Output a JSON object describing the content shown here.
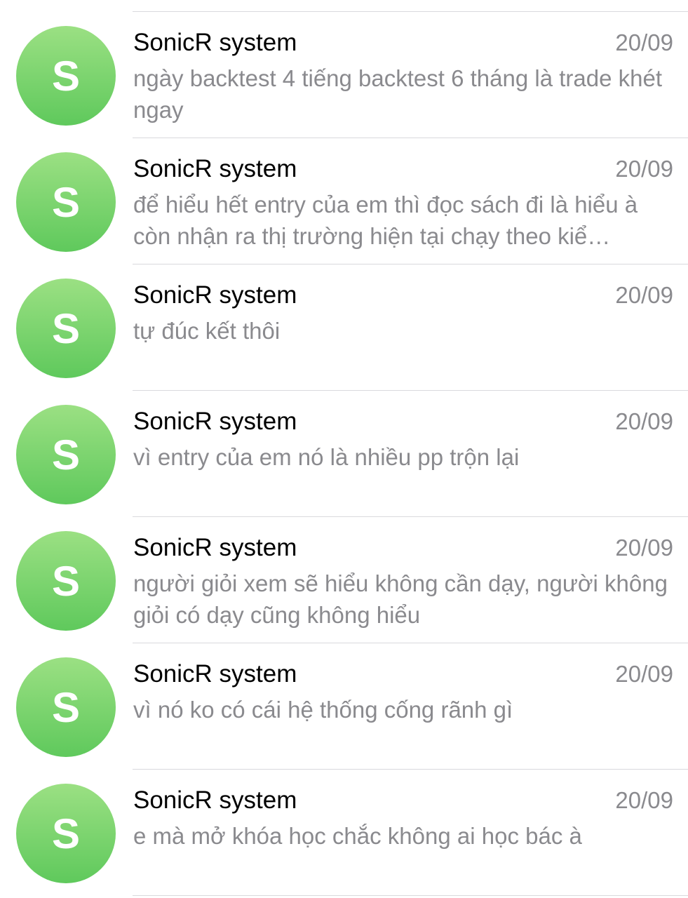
{
  "conversations": [
    {
      "avatar_letter": "S",
      "name": "SonicR system",
      "date": "20/09",
      "preview": "ngày backtest 4 tiếng backtest 6 tháng là trade khét ngay"
    },
    {
      "avatar_letter": "S",
      "name": "SonicR system",
      "date": "20/09",
      "preview": "để hiểu hết entry của em thì đọc sách đi là hiểu à còn nhận ra thị trường hiện tại chạy theo kiể…"
    },
    {
      "avatar_letter": "S",
      "name": "SonicR system",
      "date": "20/09",
      "preview": "tự đúc kết thôi"
    },
    {
      "avatar_letter": "S",
      "name": "SonicR system",
      "date": "20/09",
      "preview": "vì entry của em nó là nhiều pp trộn lại"
    },
    {
      "avatar_letter": "S",
      "name": "SonicR system",
      "date": "20/09",
      "preview": "người giỏi xem sẽ hiểu không cần dạy, người không giỏi có dạy cũng không hiểu"
    },
    {
      "avatar_letter": "S",
      "name": "SonicR system",
      "date": "20/09",
      "preview": "vì nó ko có cái hệ thống cống rãnh gì"
    },
    {
      "avatar_letter": "S",
      "name": "SonicR system",
      "date": "20/09",
      "preview": "e mà mở khóa học chắc không ai học bác à"
    }
  ],
  "colors": {
    "avatar_gradient_top": "#9be083",
    "avatar_gradient_bottom": "#5fc95c",
    "name_text": "#000000",
    "secondary_text": "#8a8a8e",
    "divider": "#d9d9dd"
  }
}
